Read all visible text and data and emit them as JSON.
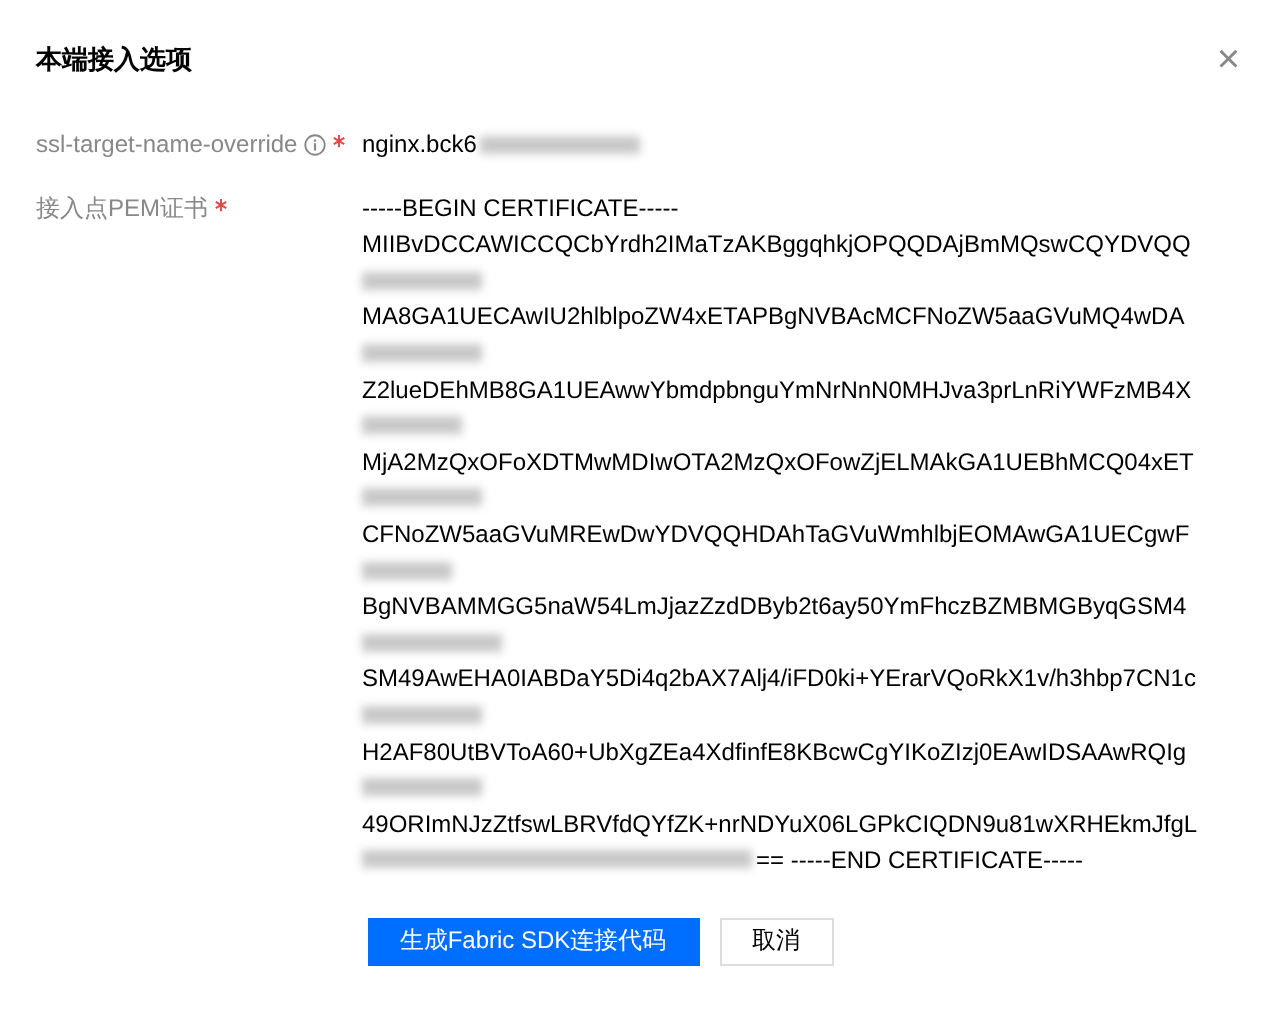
{
  "dialog": {
    "title": "本端接入选项",
    "close": "×"
  },
  "fields": [
    {
      "label": "ssl-target-name-override",
      "info": true,
      "required": true,
      "lines": [
        {
          "kind": "text",
          "text": "nginx.bck6",
          "redacted_after": true
        }
      ]
    },
    {
      "label": "接入点PEM证书",
      "info": false,
      "required": true,
      "lines": [
        {
          "kind": "text",
          "text": "-----BEGIN CERTIFICATE-----"
        },
        {
          "kind": "text",
          "text": "MIIBvDCCAWICCQCbYrdh2IMaTzAKBggqhkjOPQQDAjBmMQswCQYDVQQ"
        },
        {
          "kind": "redacted"
        },
        {
          "kind": "text",
          "text": "MA8GA1UECAwIU2hlblpoZW4xETAPBgNVBAcMCFNoZW5aaGVuMQ4wDA"
        },
        {
          "kind": "redacted"
        },
        {
          "kind": "text",
          "text": "Z2lueDEhMB8GA1UEAwwYbmdpbnguYmNrNnN0MHJva3prLnRiYWFzMB4X"
        },
        {
          "kind": "redacted"
        },
        {
          "kind": "text",
          "text": "MjA2MzQxOFoXDTMwMDIwOTA2MzQxOFowZjELMAkGA1UEBhMCQ04xET"
        },
        {
          "kind": "redacted"
        },
        {
          "kind": "text",
          "text": "CFNoZW5aaGVuMREwDwYDVQQHDAhTaGVuWmhlbjEOMAwGA1UECgwF"
        },
        {
          "kind": "redacted"
        },
        {
          "kind": "text",
          "text": "BgNVBAMMGG5naW54LmJjazZzdDByb2t6ay50YmFhczBZMBMGByqGSM4"
        },
        {
          "kind": "redacted"
        },
        {
          "kind": "text",
          "text": "SM49AwEHA0IABDaY5Di4q2bAX7Alj4/iFD0ki+YErarVQoRkX1v/h3hbp7CN1c"
        },
        {
          "kind": "redacted"
        },
        {
          "kind": "text",
          "text": "H2AF80UtBVToA60+UbXgZEa4XdfinfE8KBcwCgYIKoZIzj0EAwIDSAAwRQIg"
        },
        {
          "kind": "redacted"
        },
        {
          "kind": "text",
          "text": "49ORImNJzZtfswLBRVfdQYfZK+nrNDYuX06LGPkCIQDN9u81wXRHEkmJfgL"
        },
        {
          "kind": "text",
          "text": "== -----END CERTIFICATE-----",
          "redacted_before": true
        }
      ]
    }
  ],
  "buttons": [
    {
      "label": "生成Fabric SDK连接代码",
      "kind": "primary"
    },
    {
      "label": "取消",
      "kind": "secondary"
    }
  ]
}
